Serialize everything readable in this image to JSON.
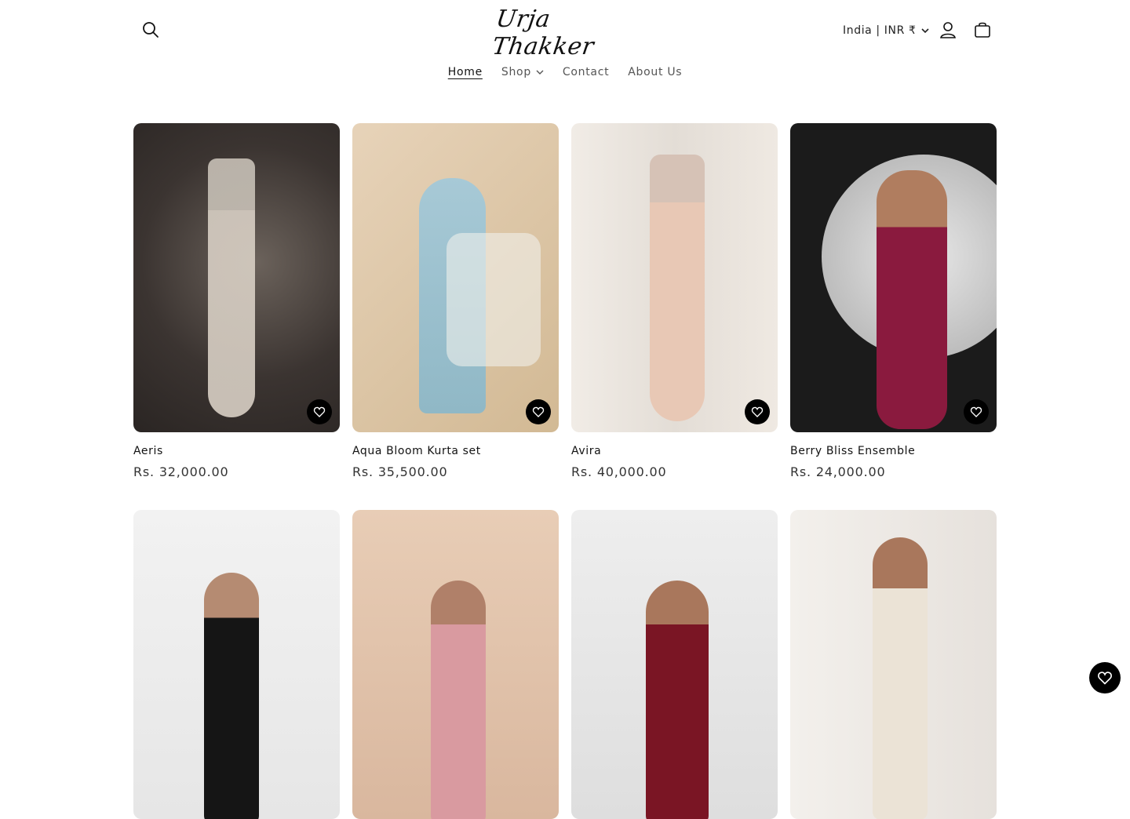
{
  "header": {
    "logo_text": "Urja Thakker",
    "country_selector": "India | INR ₹",
    "icons": [
      "search-icon",
      "account-icon",
      "cart-icon",
      "chevron-down-icon"
    ]
  },
  "nav": {
    "home": "Home",
    "shop": "Shop",
    "contact": "Contact",
    "about": "About Us"
  },
  "products": [
    {
      "title": "Aeris",
      "price": "Rs. 32,000.00"
    },
    {
      "title": "Aqua Bloom Kurta set",
      "price": "Rs. 35,500.00"
    },
    {
      "title": "Avira",
      "price": "Rs. 40,000.00"
    },
    {
      "title": "Berry Bliss Ensemble",
      "price": "Rs. 24,000.00"
    }
  ],
  "second_row_images": [
    "black saree",
    "pink drape set",
    "maroon lehenga",
    "ivory skirt set"
  ],
  "colors": {
    "accent": "#000000",
    "text": "#121212"
  }
}
